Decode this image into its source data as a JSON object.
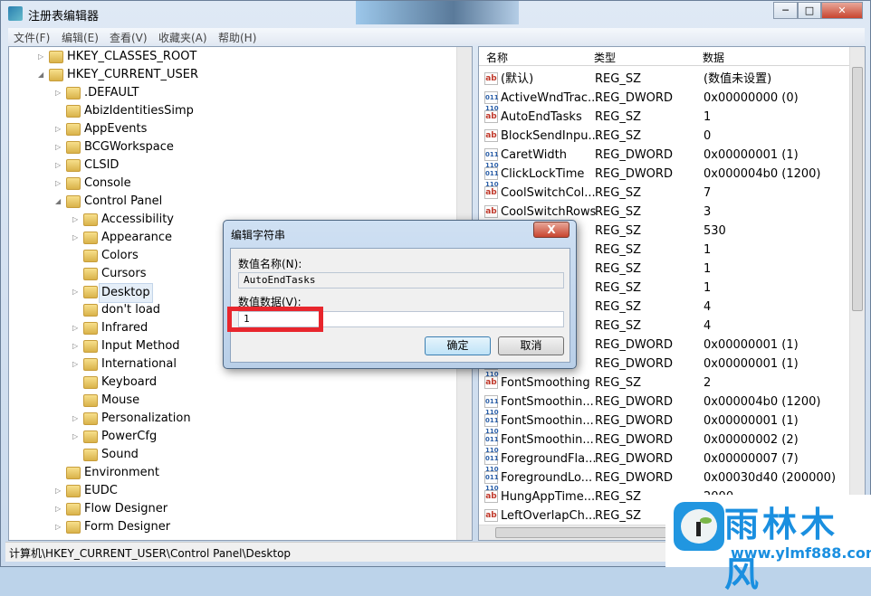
{
  "window": {
    "title": "注册表编辑器",
    "minimize": "─",
    "maximize": "□",
    "close": "✕"
  },
  "menu": [
    "文件(F)",
    "编辑(E)",
    "查看(V)",
    "收藏夹(A)",
    "帮助(H)"
  ],
  "tree": [
    {
      "label": "HKEY_CLASSES_ROOT",
      "level": 0,
      "exp": "▷"
    },
    {
      "label": "HKEY_CURRENT_USER",
      "level": 0,
      "exp": "◢"
    },
    {
      "label": ".DEFAULT",
      "level": 1,
      "exp": "▷"
    },
    {
      "label": "AbizIdentitiesSimp",
      "level": 1,
      "exp": ""
    },
    {
      "label": "AppEvents",
      "level": 1,
      "exp": "▷"
    },
    {
      "label": "BCGWorkspace",
      "level": 1,
      "exp": "▷"
    },
    {
      "label": "CLSID",
      "level": 1,
      "exp": "▷"
    },
    {
      "label": "Console",
      "level": 1,
      "exp": "▷"
    },
    {
      "label": "Control Panel",
      "level": 1,
      "exp": "◢"
    },
    {
      "label": "Accessibility",
      "level": 2,
      "exp": "▷"
    },
    {
      "label": "Appearance",
      "level": 2,
      "exp": "▷"
    },
    {
      "label": "Colors",
      "level": 2,
      "exp": ""
    },
    {
      "label": "Cursors",
      "level": 2,
      "exp": ""
    },
    {
      "label": "Desktop",
      "level": 2,
      "exp": "▷",
      "selected": true
    },
    {
      "label": "don't load",
      "level": 2,
      "exp": ""
    },
    {
      "label": "Infrared",
      "level": 2,
      "exp": "▷"
    },
    {
      "label": "Input Method",
      "level": 2,
      "exp": "▷"
    },
    {
      "label": "International",
      "level": 2,
      "exp": "▷"
    },
    {
      "label": "Keyboard",
      "level": 2,
      "exp": ""
    },
    {
      "label": "Mouse",
      "level": 2,
      "exp": ""
    },
    {
      "label": "Personalization",
      "level": 2,
      "exp": "▷"
    },
    {
      "label": "PowerCfg",
      "level": 2,
      "exp": "▷"
    },
    {
      "label": "Sound",
      "level": 2,
      "exp": ""
    },
    {
      "label": "Environment",
      "level": 1,
      "exp": ""
    },
    {
      "label": "EUDC",
      "level": 1,
      "exp": "▷"
    },
    {
      "label": "Flow Designer",
      "level": 1,
      "exp": "▷"
    },
    {
      "label": "Form Designer",
      "level": 1,
      "exp": "▷"
    }
  ],
  "columns": {
    "name": "名称",
    "type": "类型",
    "data": "数据"
  },
  "values": [
    {
      "name": "(默认)",
      "type": "REG_SZ",
      "data": "(数值未设置)"
    },
    {
      "name": "ActiveWndTrac...",
      "type": "REG_DWORD",
      "data": "0x00000000 (0)"
    },
    {
      "name": "AutoEndTasks",
      "type": "REG_SZ",
      "data": "1"
    },
    {
      "name": "BlockSendInpu...",
      "type": "REG_SZ",
      "data": "0"
    },
    {
      "name": "CaretWidth",
      "type": "REG_DWORD",
      "data": "0x00000001 (1)"
    },
    {
      "name": "ClickLockTime",
      "type": "REG_DWORD",
      "data": "0x000004b0 (1200)"
    },
    {
      "name": "CoolSwitchCol...",
      "type": "REG_SZ",
      "data": "7"
    },
    {
      "name": "CoolSwitchRows",
      "type": "REG_SZ",
      "data": "3"
    },
    {
      "name": "",
      "type": "REG_SZ",
      "data": "530"
    },
    {
      "name": "",
      "type": "REG_SZ",
      "data": "1"
    },
    {
      "name": "",
      "type": "REG_SZ",
      "data": "1"
    },
    {
      "name": "",
      "type": "REG_SZ",
      "data": "1"
    },
    {
      "name": "",
      "type": "REG_SZ",
      "data": "4"
    },
    {
      "name": "",
      "type": "REG_SZ",
      "data": "4"
    },
    {
      "name": "",
      "type": "REG_DWORD",
      "data": "0x00000001 (1)"
    },
    {
      "name": "",
      "type": "REG_DWORD",
      "data": "0x00000001 (1)"
    },
    {
      "name": "FontSmoothing",
      "type": "REG_SZ",
      "data": "2"
    },
    {
      "name": "FontSmoothin...",
      "type": "REG_DWORD",
      "data": "0x000004b0 (1200)"
    },
    {
      "name": "FontSmoothin...",
      "type": "REG_DWORD",
      "data": "0x00000001 (1)"
    },
    {
      "name": "FontSmoothin...",
      "type": "REG_DWORD",
      "data": "0x00000002 (2)"
    },
    {
      "name": "ForegroundFla...",
      "type": "REG_DWORD",
      "data": "0x00000007 (7)"
    },
    {
      "name": "ForegroundLo...",
      "type": "REG_DWORD",
      "data": "0x00030d40 (200000)"
    },
    {
      "name": "HungAppTime...",
      "type": "REG_SZ",
      "data": "2000"
    },
    {
      "name": "LeftOverlapCh...",
      "type": "REG_SZ",
      "data": ""
    }
  ],
  "status": "计算机\\HKEY_CURRENT_USER\\Control Panel\\Desktop",
  "dialog": {
    "title": "编辑字符串",
    "name_label": "数值名称(N):",
    "name_value": "AutoEndTasks",
    "data_label": "数值数据(V):",
    "data_value": "1",
    "ok": "确定",
    "cancel": "取消",
    "close": "X",
    "highlight_color": "#e8262d"
  },
  "watermark": {
    "brand": "雨林木风",
    "url": "www.ylmf888.com",
    "color": "#1a8fe0"
  }
}
